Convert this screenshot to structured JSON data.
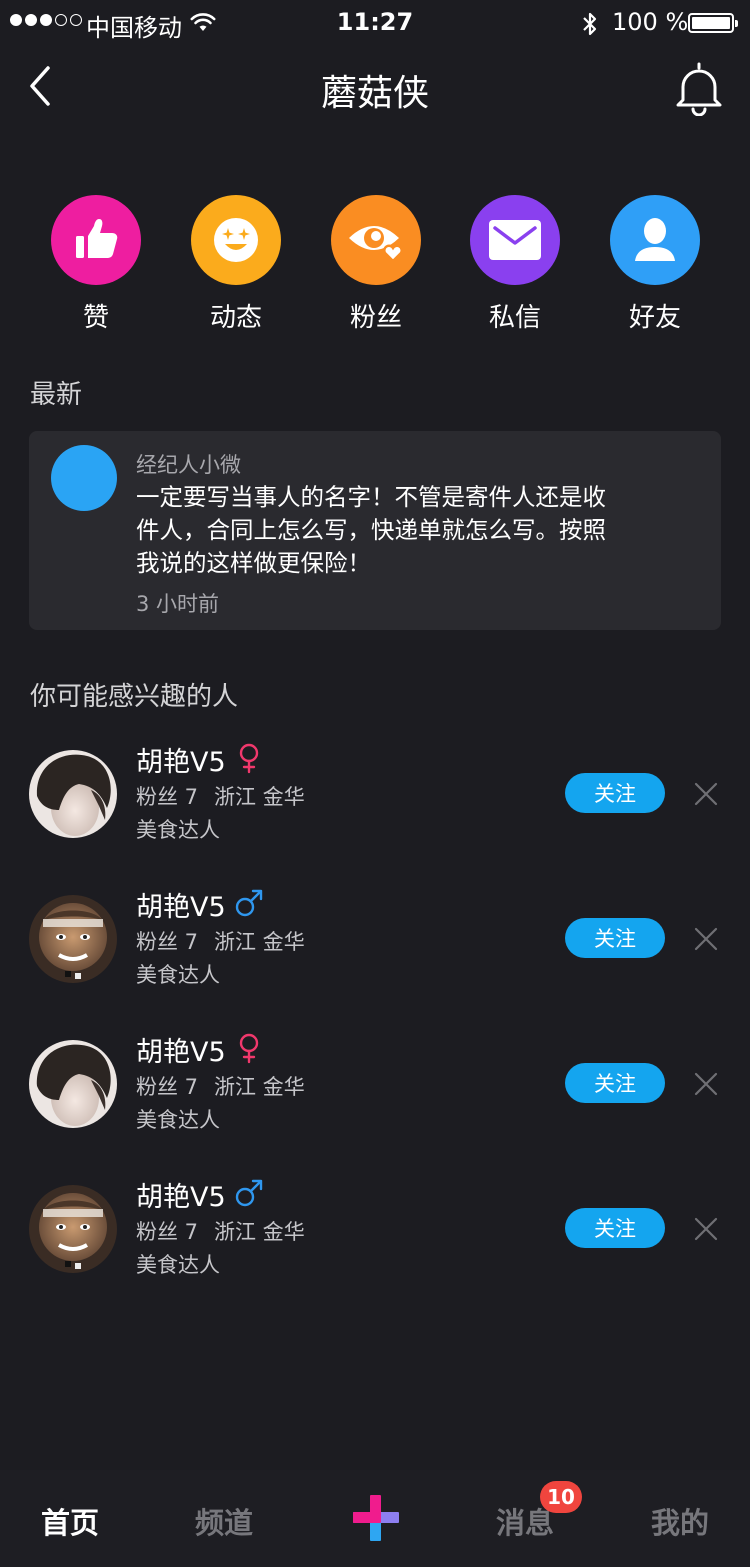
{
  "status_bar": {
    "carrier": "中国移动",
    "time": "11:27",
    "battery": "100 %"
  },
  "nav": {
    "title": "蘑菇侠"
  },
  "actions": [
    {
      "label": "赞",
      "icon": "thumbs-up-icon",
      "color": "#ee1ea0"
    },
    {
      "label": "动态",
      "icon": "smiley-icon",
      "color": "#fbab1c"
    },
    {
      "label": "粉丝",
      "icon": "eye-heart-icon",
      "color": "#fa8d22"
    },
    {
      "label": "私信",
      "icon": "mail-icon",
      "color": "#8a40ef"
    },
    {
      "label": "好友",
      "icon": "person-icon",
      "color": "#2f9ff7"
    }
  ],
  "latest": {
    "title": "最新",
    "author": "经纪人小微",
    "content": "一定要写当事人的名字！不管是寄件人还是收件人，合同上怎么写，快递单就怎么写。按照我说的这样做更保险！",
    "time": "3 小时前"
  },
  "suggest": {
    "title": "你可能感兴趣的人",
    "people": [
      {
        "name": "胡艳V5",
        "gender": "female",
        "fans": "粉丝 7",
        "location": "浙江 金华",
        "tag": "美食达人",
        "follow_label": "关注"
      },
      {
        "name": "胡艳V5",
        "gender": "male",
        "fans": "粉丝 7",
        "location": "浙江 金华",
        "tag": "美食达人",
        "follow_label": "关注"
      },
      {
        "name": "胡艳V5",
        "gender": "female",
        "fans": "粉丝 7",
        "location": "浙江 金华",
        "tag": "美食达人",
        "follow_label": "关注"
      },
      {
        "name": "胡艳V5",
        "gender": "male",
        "fans": "粉丝 7",
        "location": "浙江 金华",
        "tag": "美食达人",
        "follow_label": "关注"
      }
    ]
  },
  "tabbar": {
    "home": "首页",
    "channel": "频道",
    "messages": "消息",
    "messages_badge": "10",
    "mine": "我的"
  },
  "colors": {
    "background": "#1c1c21",
    "card": "#2a2a2f",
    "accent_blue": "#14a5ef",
    "female": "#f0386c",
    "male": "#2f97ee",
    "badge": "#f0453e"
  }
}
